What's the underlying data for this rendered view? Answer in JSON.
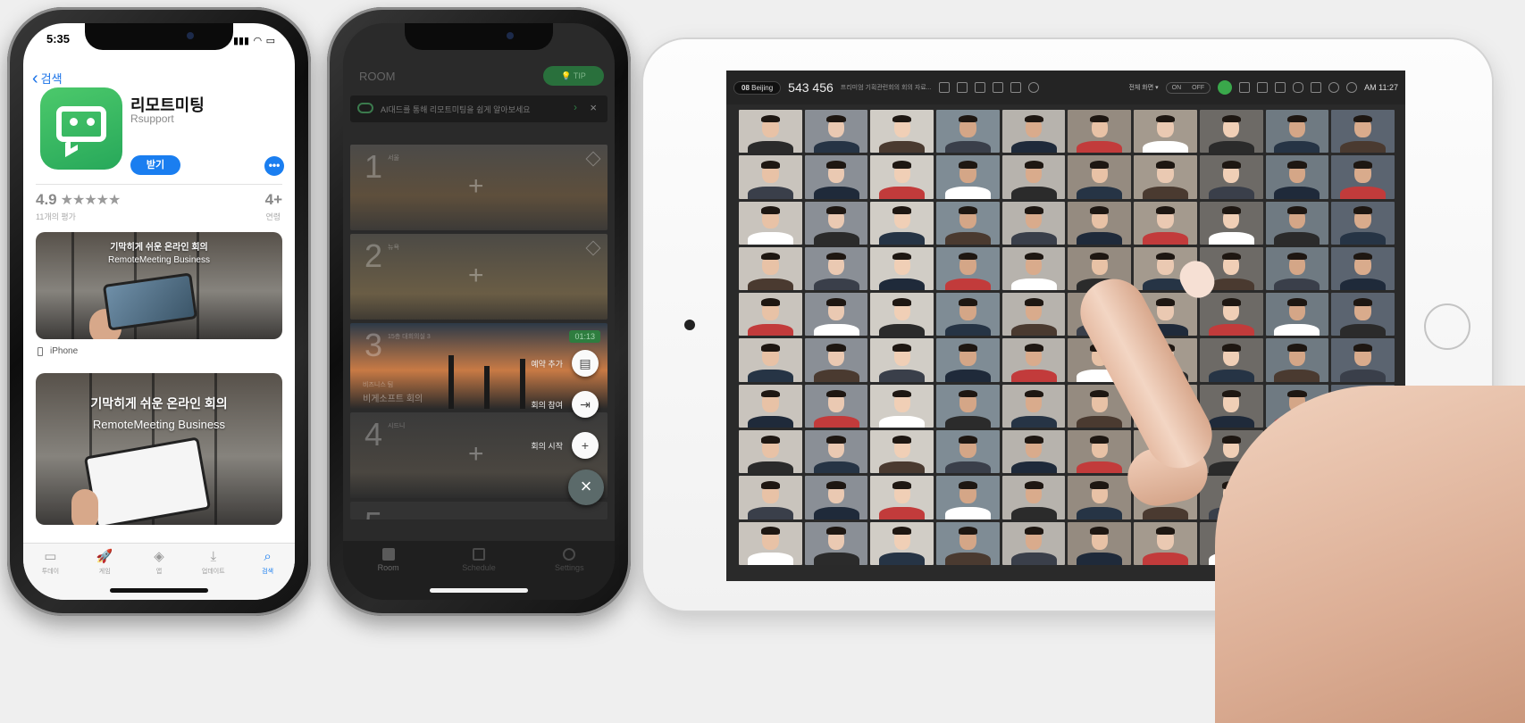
{
  "app_store": {
    "time": "5:35",
    "back_label": "검색",
    "app_name": "리모트미팅",
    "developer": "Rsupport",
    "get_label": "받기",
    "more_label": "•••",
    "rating_value": "4.9",
    "rating_stars": "★★★★★",
    "rating_count": "11개의 평가",
    "age_value": "4+",
    "age_label": "연령",
    "screenshot_headline": "기막히게 쉬운 온라인 회의",
    "screenshot_brand": "RemoteMeeting Business",
    "device_label": "iPhone",
    "tabs": [
      {
        "label": "투데이",
        "icon": "▭"
      },
      {
        "label": "게임",
        "icon": "🚀"
      },
      {
        "label": "앱",
        "icon": "◈"
      },
      {
        "label": "업데이트",
        "icon": "⤓"
      },
      {
        "label": "검색",
        "icon": "⌕"
      }
    ],
    "colors": {
      "accent": "#1a7ef0",
      "app_icon": "#3dbd63"
    }
  },
  "remote_meeting": {
    "title": "ROOM",
    "tip_label": "TIP",
    "banner_text": "AI대드를 통해 리모트미팅을 쉽게 알아보세요",
    "rooms": [
      {
        "number": "1",
        "label": "서울"
      },
      {
        "number": "2",
        "label": "뉴욕"
      },
      {
        "number": "3",
        "label": "15층 대회의실 3",
        "timer": "01:13",
        "subtitle": "비즈니스 팀",
        "name": "비게소프트 회의"
      },
      {
        "number": "4",
        "label": "시드니"
      },
      {
        "number": "5",
        "label": ""
      }
    ],
    "actions": [
      {
        "label": "예약 추가",
        "icon": "▤"
      },
      {
        "label": "회의 참여",
        "icon": "⇥"
      },
      {
        "label": "회의 시작",
        "icon": "+"
      }
    ],
    "close_icon": "×",
    "tabs": [
      {
        "label": "Room"
      },
      {
        "label": "Schedule"
      },
      {
        "label": "Settings"
      }
    ]
  },
  "tablet": {
    "room_badge": "08",
    "room_badge_label": "Beijing",
    "meeting_code": "543 456",
    "meeting_title": "프리미엄 기획관련회의 회의 자료...",
    "view_toggle": "전체 화면 ▾",
    "on_label": "ON",
    "off_label": "OFF",
    "clock": "AM 11:27",
    "participant_rows": 10,
    "participant_cols": 10
  }
}
